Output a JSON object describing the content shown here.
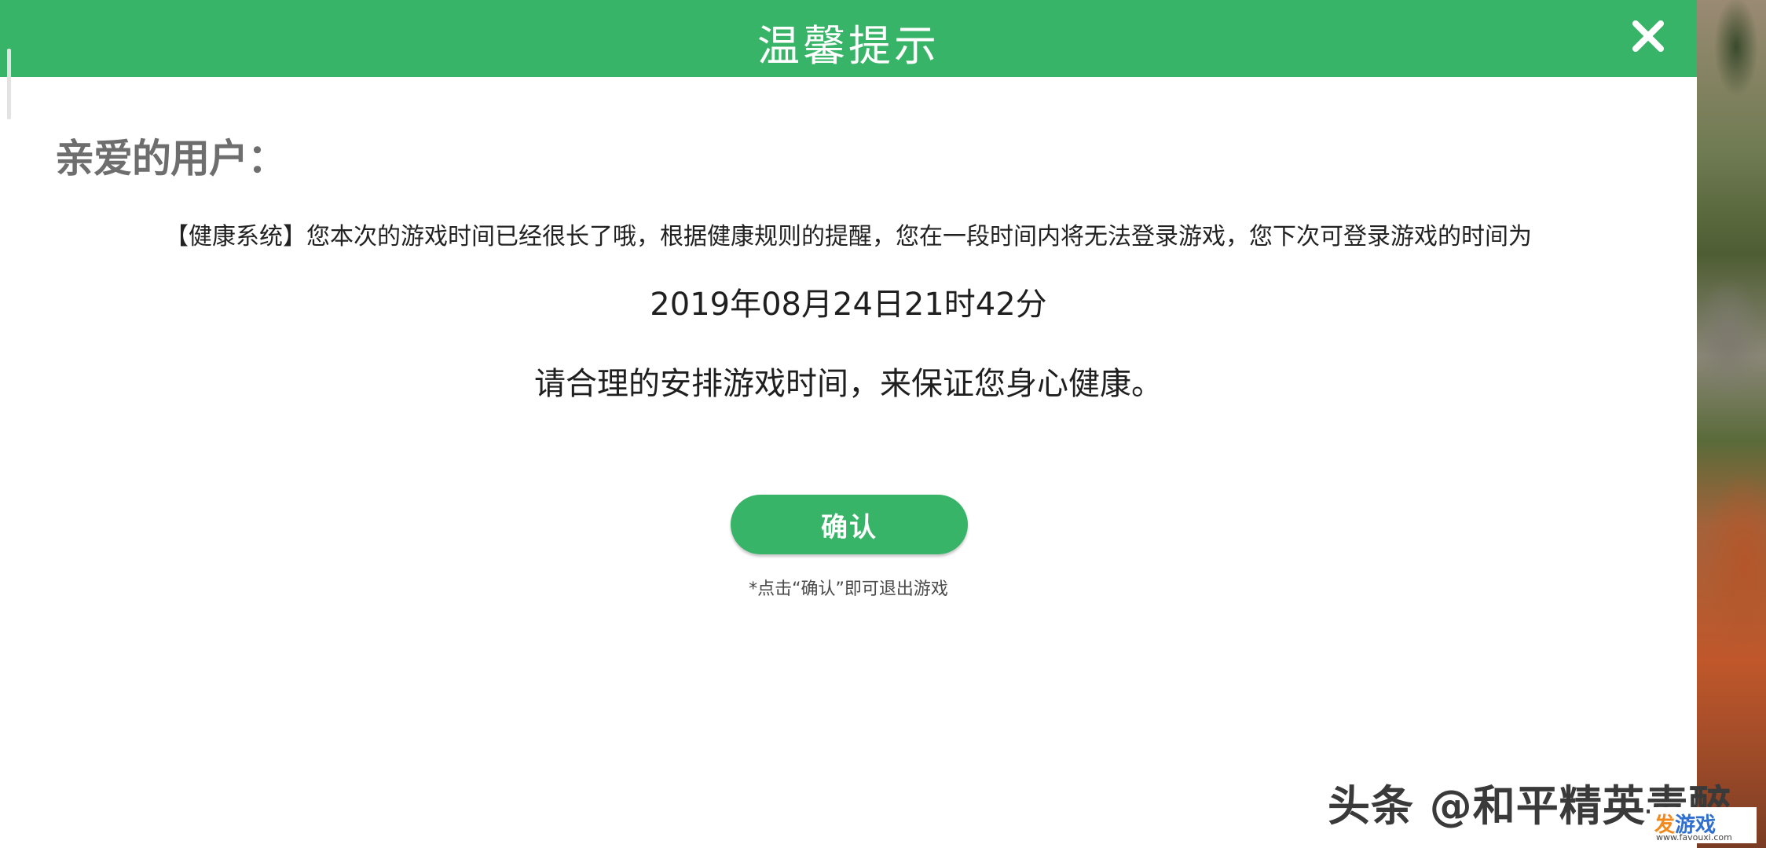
{
  "dialog": {
    "title": "温馨提示",
    "greeting": "亲爱的用户：",
    "message": "【健康系统】您本次的游戏时间已经很长了哦，根据健康规则的提醒，您在一段时间内将无法登录游戏，您下次可登录游戏的时间为",
    "next_login_time": "2019年08月24日21时42分",
    "advice": "请合理的安排游戏时间，来保证您身心健康。",
    "confirm_label": "确认",
    "hint": "*点击“确认”即可退出游戏"
  },
  "icons": {
    "close": "close-icon"
  },
  "colors": {
    "header": "#38b468",
    "button": "#38b468"
  },
  "watermark": {
    "text": "头条 @和平精英毒醉",
    "site_brand_accent": "发",
    "site_brand_rest": "游戏",
    "site_domain": "www.favouxi.com"
  }
}
